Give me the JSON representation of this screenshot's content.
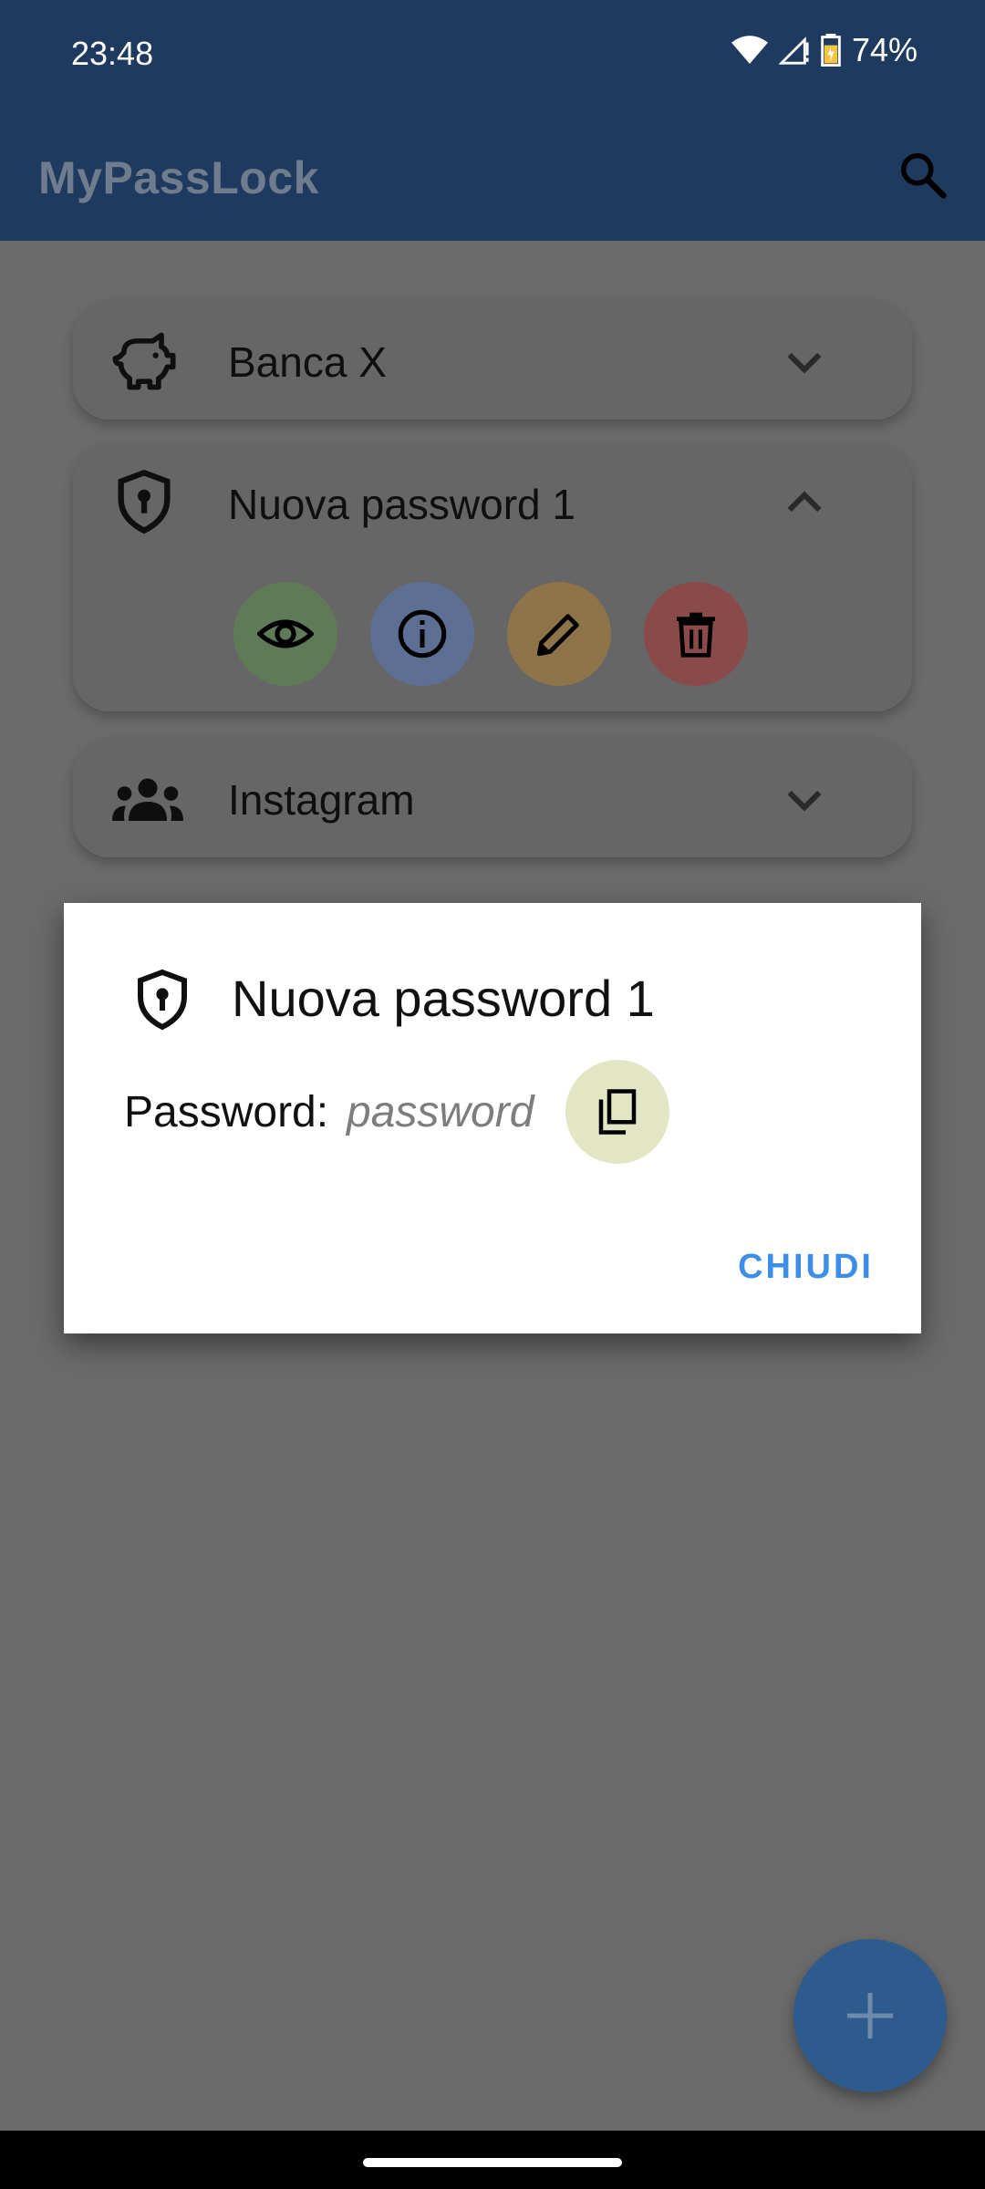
{
  "status_bar": {
    "time": "23:48",
    "battery": "74%"
  },
  "app_bar": {
    "title": "MyPassLock"
  },
  "cards": [
    {
      "label": "Banca X",
      "icon": "piggy-bank-icon",
      "expanded": false
    },
    {
      "label": "Nuova password 1",
      "icon": "shield-lock-icon",
      "expanded": true
    },
    {
      "label": "Instagram",
      "icon": "group-icon",
      "expanded": false
    }
  ],
  "card_actions": [
    {
      "icon": "eye-icon",
      "color": "#5f7a57"
    },
    {
      "icon": "info-icon",
      "color": "#5d6f92"
    },
    {
      "icon": "pencil-icon",
      "color": "#8f7449"
    },
    {
      "icon": "trash-icon",
      "color": "#8b4a4a"
    }
  ],
  "dialog": {
    "title": "Nuova password 1",
    "password_label": "Password:",
    "password_value": "password",
    "close_label": "CHIUDI"
  },
  "colors": {
    "primary": "#1f3a5f",
    "accent_text": "#3d8ee8",
    "fab": "#2e5b8e",
    "copy_button": "#e3e6c5"
  }
}
